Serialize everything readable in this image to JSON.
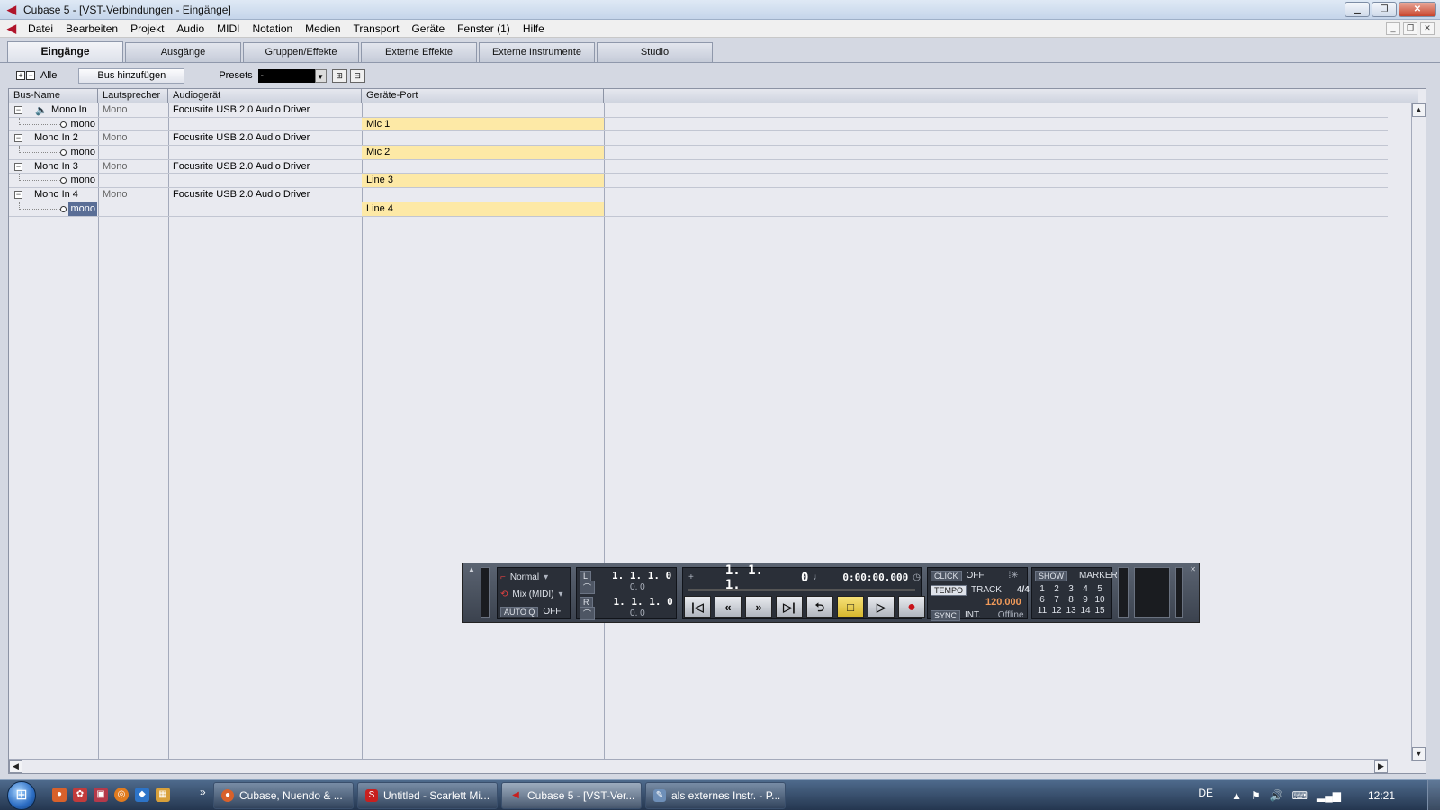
{
  "window": {
    "title": "Cubase 5 - [VST-Verbindungen - Eingänge]",
    "app_icon": "cubase-logo-icon"
  },
  "menu": {
    "items": [
      "Datei",
      "Bearbeiten",
      "Projekt",
      "Audio",
      "MIDI",
      "Notation",
      "Medien",
      "Transport",
      "Geräte",
      "Fenster (1)",
      "Hilfe"
    ]
  },
  "tabs": [
    {
      "label": "Eingänge",
      "active": true
    },
    {
      "label": "Ausgänge",
      "active": false
    },
    {
      "label": "Gruppen/Effekte",
      "active": false
    },
    {
      "label": "Externe Effekte",
      "active": false
    },
    {
      "label": "Externe Instrumente",
      "active": false
    },
    {
      "label": "Studio",
      "active": false
    }
  ],
  "toolbar": {
    "all_label": "Alle",
    "add_bus_label": "Bus hinzufügen",
    "presets_label": "Presets",
    "presets_value": "-"
  },
  "table": {
    "headers": [
      "Bus-Name",
      "Lautsprecher",
      "Audiogerät",
      "Geräte-Port"
    ],
    "rows": [
      {
        "bus": "Mono In",
        "speaker": "Mono",
        "device": "Focusrite USB 2.0 Audio Driver",
        "port": ""
      },
      {
        "bus": "mono",
        "speaker": "",
        "device": "",
        "port": "Mic 1"
      },
      {
        "bus": "Mono In 2",
        "speaker": "Mono",
        "device": "Focusrite USB 2.0 Audio Driver",
        "port": ""
      },
      {
        "bus": "mono",
        "speaker": "",
        "device": "",
        "port": "Mic 2"
      },
      {
        "bus": "Mono In 3",
        "speaker": "Mono",
        "device": "Focusrite USB 2.0 Audio Driver",
        "port": ""
      },
      {
        "bus": "mono",
        "speaker": "",
        "device": "",
        "port": "Line 3"
      },
      {
        "bus": "Mono In 4",
        "speaker": "Mono",
        "device": "Focusrite USB 2.0 Audio Driver",
        "port": ""
      },
      {
        "bus": "mono",
        "speaker": "",
        "device": "",
        "port": "Line 4"
      }
    ]
  },
  "transport": {
    "mode": "Normal",
    "mix": "Mix (MIDI)",
    "autoq_label": "AUTO Q",
    "autoq_value": "OFF",
    "left_locator": "1. 1. 1.   0",
    "left_sub": "0.   0",
    "right_locator": "1. 1. 1.   0",
    "right_sub": "0.   0",
    "position_bars": "1. 1. 1.",
    "position_ticks": "0",
    "position_time": "0:00:00.000",
    "click_label": "CLICK",
    "click_value": "OFF",
    "tempo_label": "TEMPO",
    "tempo_mode": "TRACK",
    "signature": "4/4",
    "tempo_value": "120.000",
    "sync_label": "SYNC",
    "sync_source": "INT.",
    "sync_status": "Offline",
    "show_label": "SHOW",
    "marker_label": "MARKER",
    "markers": [
      "1",
      "2",
      "3",
      "4",
      "5",
      "6",
      "7",
      "8",
      "9",
      "10",
      "11",
      "12",
      "13",
      "14",
      "15"
    ]
  },
  "taskbar": {
    "tasks": [
      {
        "label": "Cubase, Nuendo & ...",
        "icon": "firefox-icon",
        "active": false
      },
      {
        "label": "Untitled - Scarlett Mi...",
        "icon": "scarlett-mixcontrol-icon",
        "active": false
      },
      {
        "label": "Cubase 5 - [VST-Ver...",
        "icon": "cubase-icon",
        "active": true
      },
      {
        "label": "als externes Instr. - P...",
        "icon": "paint-icon",
        "active": false
      }
    ],
    "language": "DE",
    "clock": "12:21"
  }
}
